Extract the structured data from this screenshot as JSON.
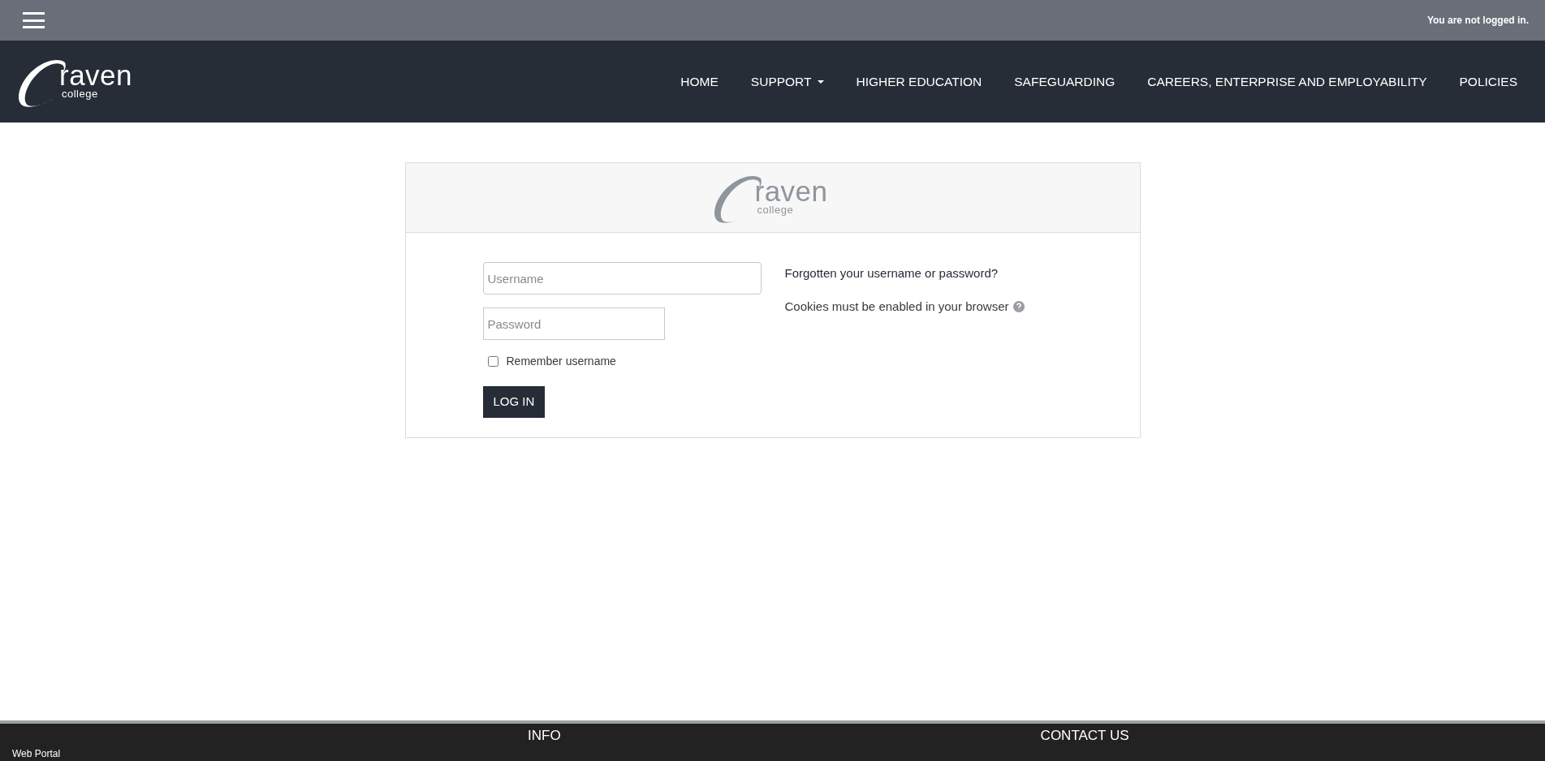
{
  "top_bar": {
    "login_status": "You are not logged in."
  },
  "logo": {
    "word": "raven",
    "sub": "college"
  },
  "nav": [
    {
      "label": "HOME",
      "dropdown": false
    },
    {
      "label": "SUPPORT",
      "dropdown": true
    },
    {
      "label": "HIGHER EDUCATION",
      "dropdown": false
    },
    {
      "label": "SAFEGUARDING",
      "dropdown": false
    },
    {
      "label": "CAREERS, ENTERPRISE AND EMPLOYABILITY",
      "dropdown": false
    },
    {
      "label": "POLICIES",
      "dropdown": false
    }
  ],
  "login_card": {
    "logo": {
      "word": "raven",
      "sub": "college"
    },
    "username": {
      "placeholder": "Username"
    },
    "password": {
      "placeholder": "Password"
    },
    "remember": {
      "label": "Remember username",
      "checked": false
    },
    "button": "LOG IN",
    "forgotten_link": "Forgotten your username or password?",
    "cookies_note": "Cookies must be enabled in your browser"
  },
  "footer": {
    "headings": [
      "INFO",
      "CONTACT US"
    ],
    "link": "Web Portal"
  }
}
